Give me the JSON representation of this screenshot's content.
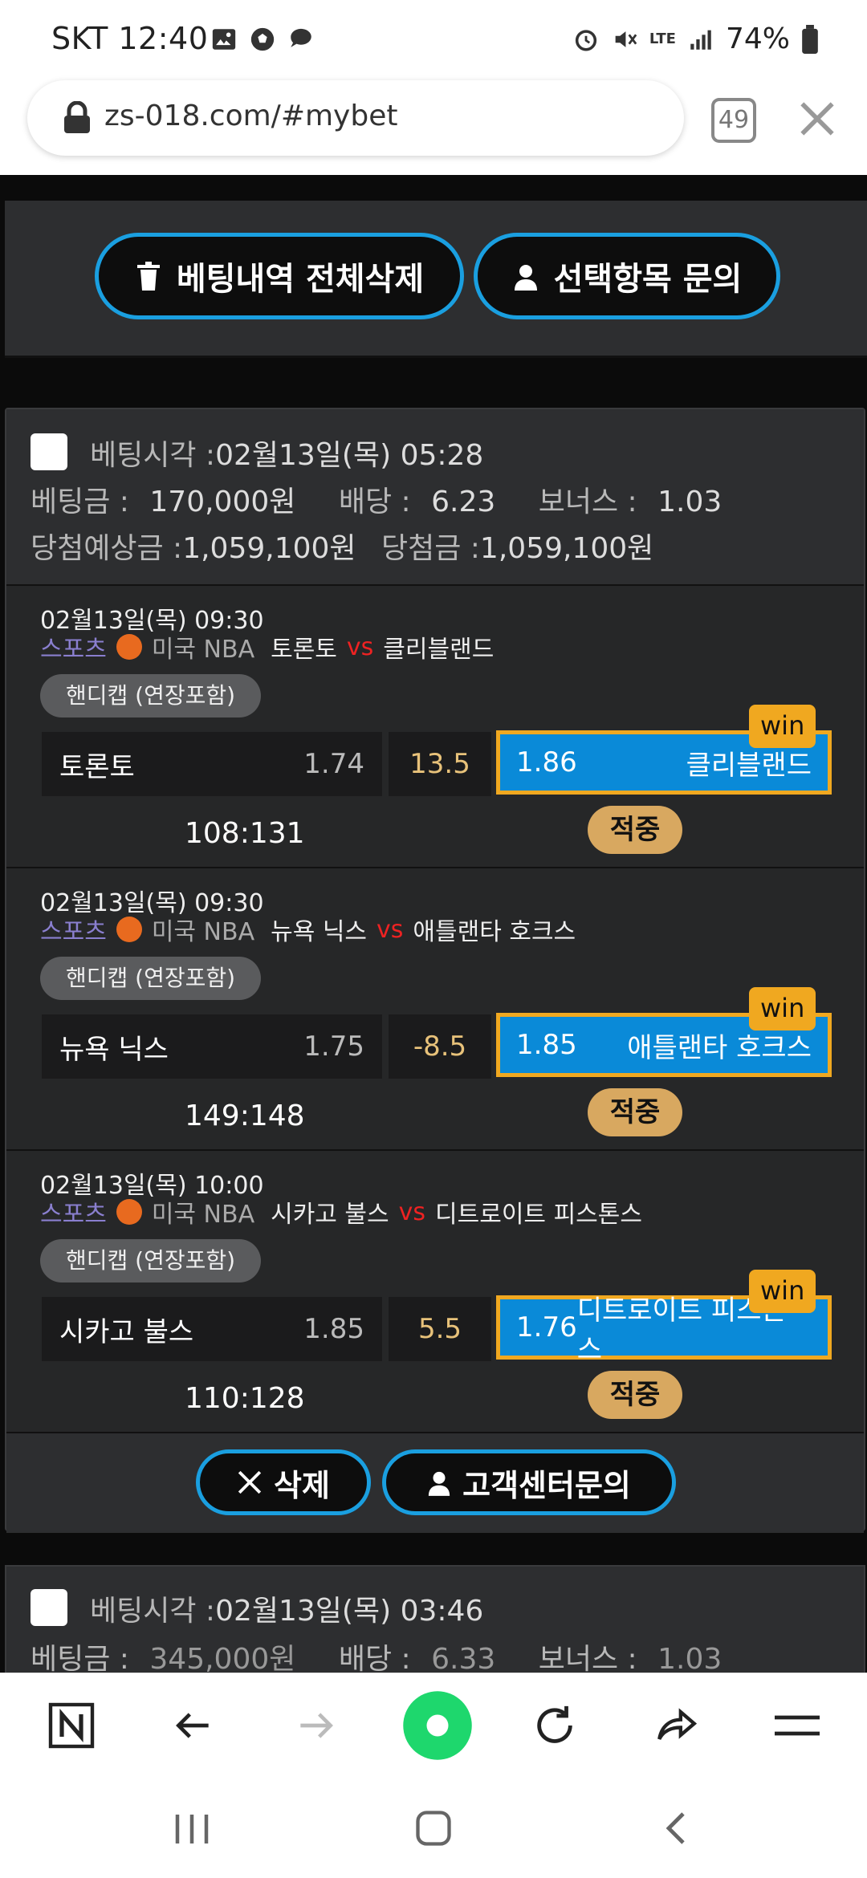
{
  "status": {
    "carrier_time": "SKT 12:40",
    "battery": "74%",
    "network": "LTE"
  },
  "browser": {
    "url": "zs-018.com/#mybet",
    "tab_count": "49"
  },
  "top_actions": {
    "delete_all": "베팅내역 전체삭제",
    "inquire_selected": "선택항목 문의"
  },
  "bet": {
    "bet_time_label": "베팅시각 :",
    "bet_time": "02월13일(목) 05:28",
    "amount_label": "베팅금 :",
    "amount": "170,000원",
    "odds_label": "배당 :",
    "odds": "6.23",
    "bonus_label": "보너스 :",
    "bonus": "1.03",
    "expected_label": "당첨예상금 :",
    "expected": "1,059,100원",
    "won_label": "당첨금 :",
    "won": "1,059,100원",
    "games": [
      {
        "date": "02월13일(목) 09:30",
        "sport": "스포츠",
        "league": "미국 NBA",
        "home": "토론토",
        "vs": "vs",
        "away": "클리블랜드",
        "market": "핸디캡 (연장포함)",
        "home_odds": "1.74",
        "line": "13.5",
        "away_odds": "1.86",
        "badge": "win",
        "score": "108:131",
        "result": "적중"
      },
      {
        "date": "02월13일(목) 09:30",
        "sport": "스포츠",
        "league": "미국 NBA",
        "home": "뉴욕 닉스",
        "vs": "vs",
        "away": "애틀랜타 호크스",
        "market": "핸디캡 (연장포함)",
        "home_odds": "1.75",
        "line": "-8.5",
        "away_odds": "1.85",
        "badge": "win",
        "score": "149:148",
        "result": "적중"
      },
      {
        "date": "02월13일(목) 10:00",
        "sport": "스포츠",
        "league": "미국 NBA",
        "home": "시카고 불스",
        "vs": "vs",
        "away": "디트로이트 피스톤스",
        "market": "핸디캡 (연장포함)",
        "home_odds": "1.85",
        "line": "5.5",
        "away_odds": "1.76",
        "badge": "win",
        "score": "110:128",
        "result": "적중"
      }
    ],
    "delete_label": "삭제",
    "support_label": "고객센터문의"
  },
  "next_bet": {
    "bet_time_label": "베팅시각 :",
    "bet_time": "02월13일(목) 03:46",
    "amount_label": "베팅금 :",
    "amount": "345,000원",
    "odds_label": "배당 :",
    "odds": "6.33",
    "bonus_label": "보너스 :",
    "bonus": "1.03"
  },
  "colors": {
    "accent_blue": "#1a9fe0",
    "win_orange": "#f0a820",
    "result_gold": "#d8a860",
    "card_bg": "#2d2e30"
  }
}
